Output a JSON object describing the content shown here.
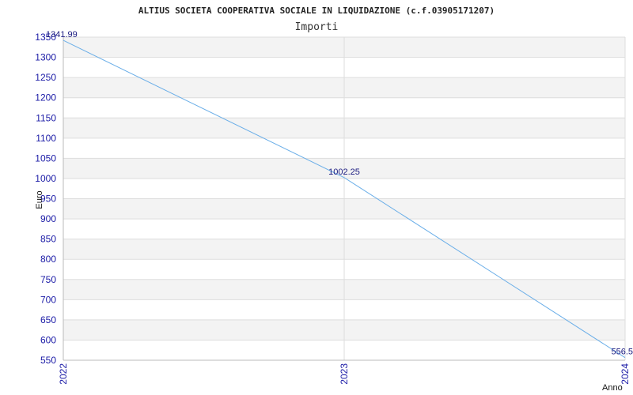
{
  "chart_data": {
    "type": "line",
    "title": "ALTIUS SOCIETA COOPERATIVA SOCIALE IN LIQUIDAZIONE (c.f.03905171207)",
    "subtitle": "Importi",
    "xlabel": "Anno",
    "ylabel": "Euro",
    "categories": [
      "2022",
      "2023",
      "2024"
    ],
    "series": [
      {
        "values": [
          1341.99,
          1002.25,
          556.5
        ],
        "labels": [
          "1341.99",
          "1002.25",
          "556.5"
        ]
      }
    ],
    "ylim": [
      550,
      1350
    ],
    "yticks": [
      "550",
      "600",
      "650",
      "700",
      "750",
      "800",
      "850",
      "900",
      "950",
      "1000",
      "1050",
      "1100",
      "1150",
      "1200",
      "1250",
      "1300",
      "1350"
    ],
    "grid": true,
    "colors": {
      "line": "#6aaee8",
      "band": "#f3f3f3",
      "tick_text": "#1a1aa6"
    }
  }
}
